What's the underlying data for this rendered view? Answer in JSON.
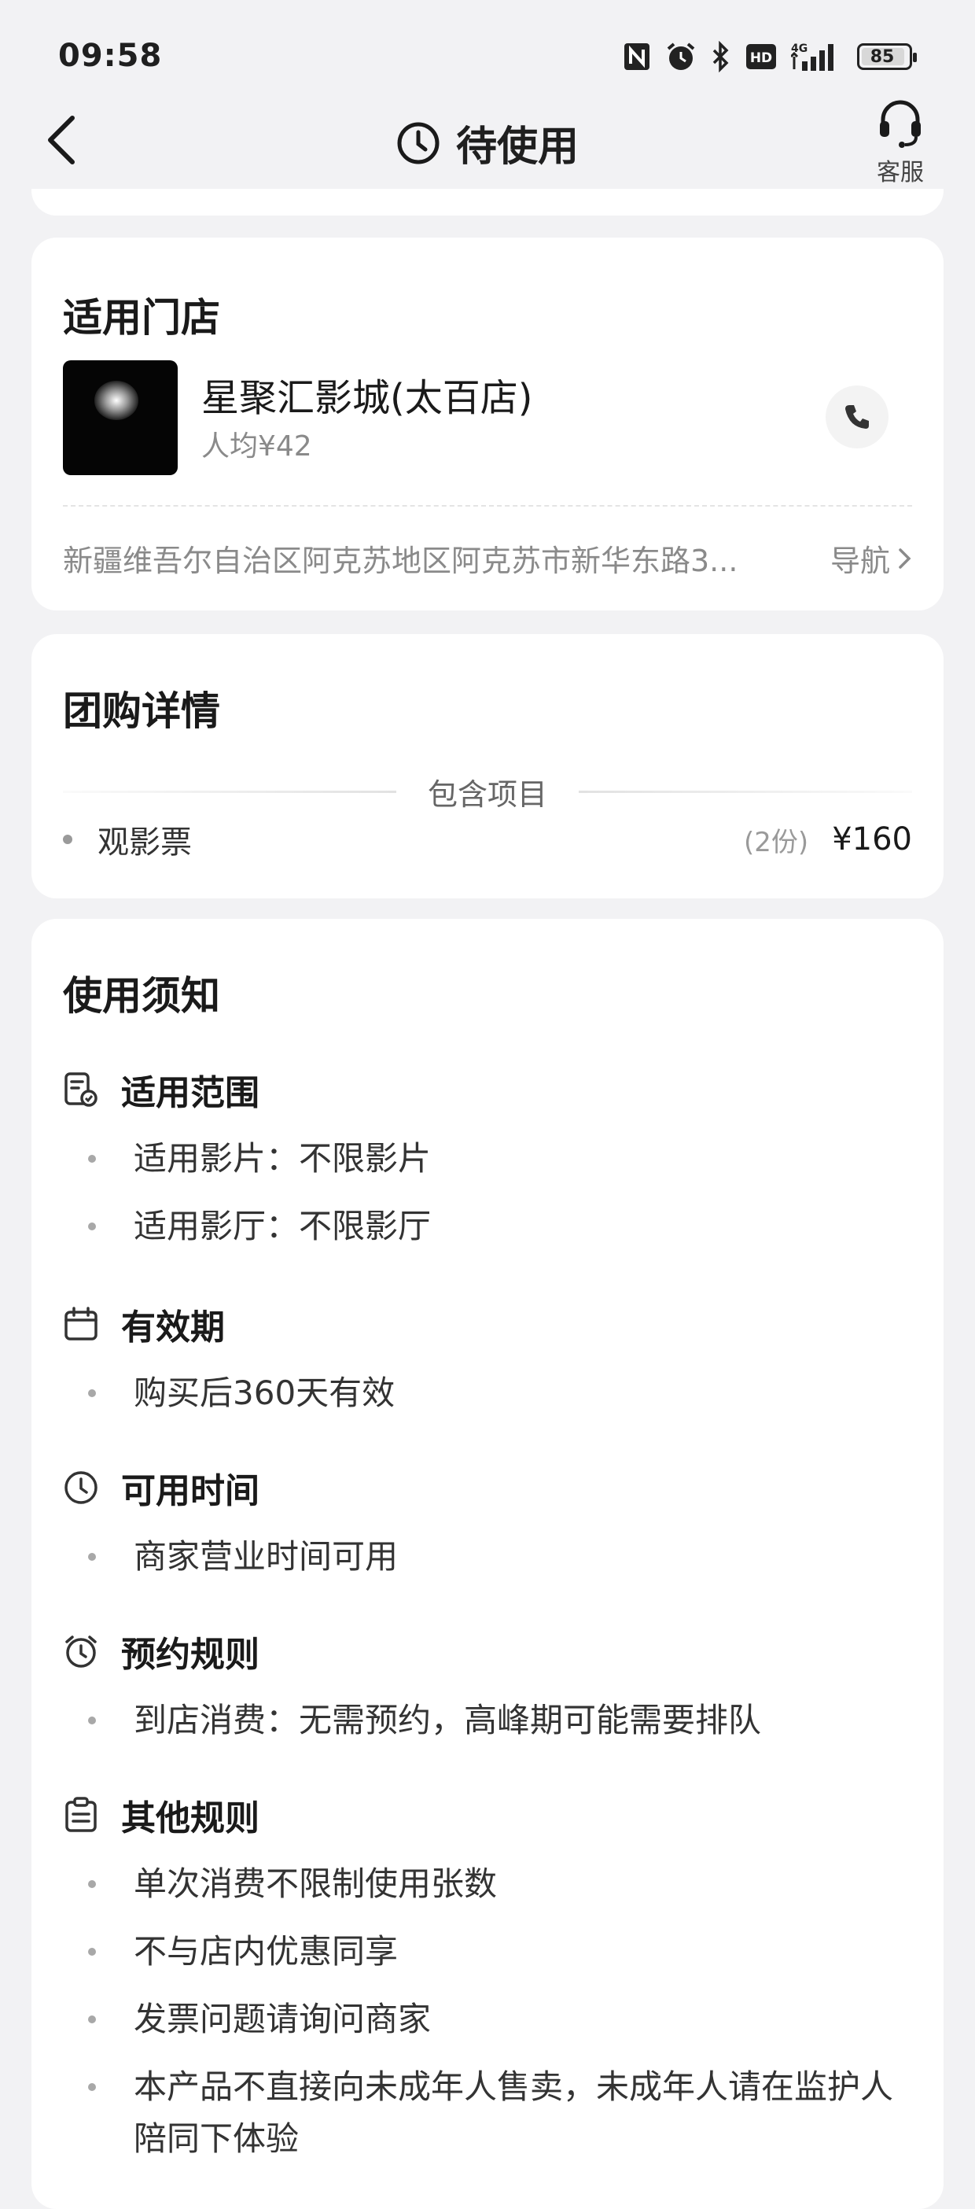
{
  "status_bar": {
    "time": "09:58",
    "network": "4G",
    "hd": "HD",
    "battery": "85"
  },
  "nav": {
    "title": "待使用",
    "service_label": "客服"
  },
  "store": {
    "section_title": "适用门店",
    "name": "星聚汇影城(太百店)",
    "price": "人均¥42",
    "address": "新疆维吾尔自治区阿克苏地区阿克苏市新华东路3...",
    "nav_label": "导航"
  },
  "deal": {
    "section_title": "团购详情",
    "include_label": "包含项目",
    "items": [
      {
        "name": "观影票",
        "qty": "(2份)",
        "price": "¥160"
      }
    ]
  },
  "notice": {
    "section_title": "使用须知",
    "groups": [
      {
        "title": "适用范围",
        "icon": "checklist-icon",
        "items": [
          "适用影片：不限影片",
          "适用影厅：不限影厅"
        ]
      },
      {
        "title": "有效期",
        "icon": "calendar-icon",
        "items": [
          "购买后360天有效"
        ]
      },
      {
        "title": "可用时间",
        "icon": "clock-icon",
        "items": [
          "商家营业时间可用"
        ]
      },
      {
        "title": "预约规则",
        "icon": "alarm-icon",
        "items": [
          "到店消费：无需预约，高峰期可能需要排队"
        ]
      },
      {
        "title": "其他规则",
        "icon": "clipboard-icon",
        "items": [
          "单次消费不限制使用张数",
          "不与店内优惠同享",
          "发票问题请询问商家",
          "本产品不直接向未成年人售卖，未成年人请在监护人陪同下体验"
        ]
      }
    ]
  }
}
